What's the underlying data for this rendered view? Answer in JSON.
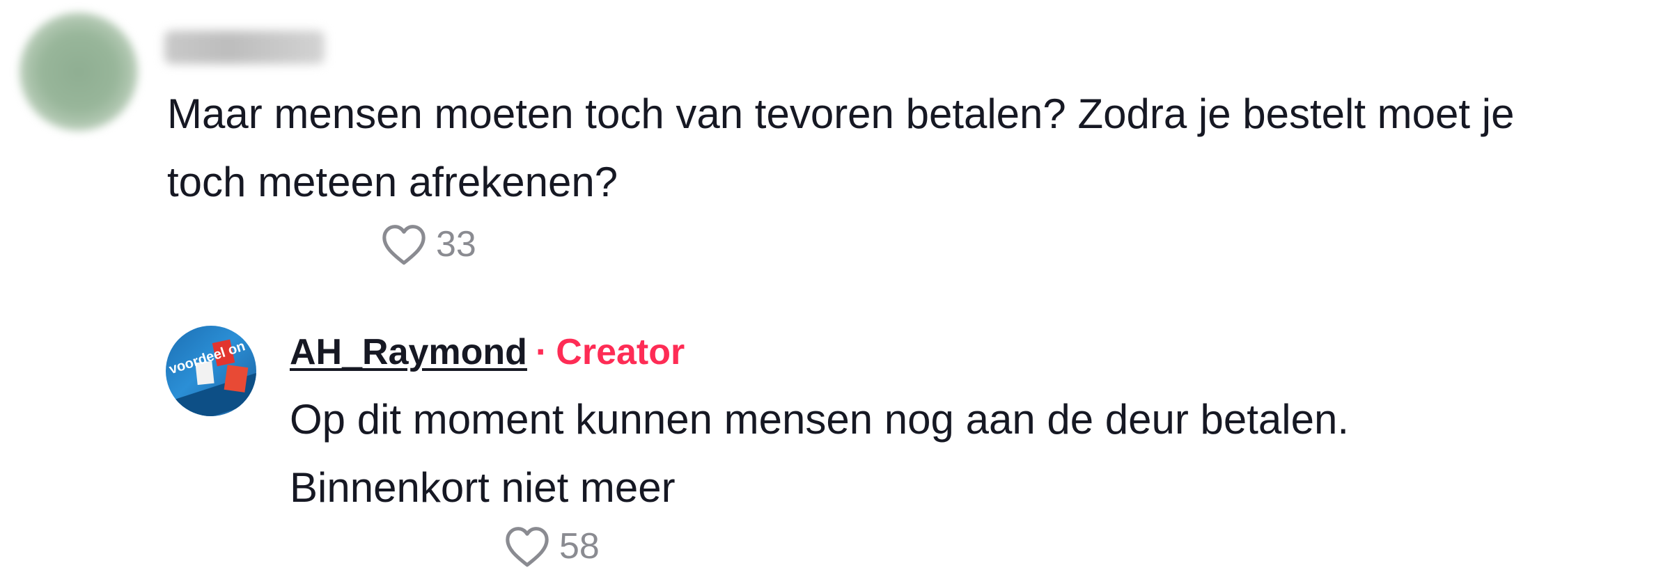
{
  "comments": [
    {
      "username": "",
      "text_lines": [
        "Maar mensen moeten toch van tevoren betalen? Zodra je bestelt moet je",
        "toch meteen afrekenen?"
      ],
      "likes": "33",
      "avatar": "blurred-avatar",
      "like_icon": "heart-outline-icon"
    },
    {
      "username": "AH_Raymond",
      "separator": "·",
      "badge": "Creator",
      "text_lines": [
        "Op dit moment kunnen mensen nog aan de deur betalen.",
        "Binnenkort niet meer"
      ],
      "likes": "58",
      "avatar_text": "voordeel on ag.",
      "like_icon": "heart-outline-icon"
    }
  ],
  "colors": {
    "text": "#161823",
    "muted": "#8a8b91",
    "creator": "#fe2c55",
    "background": "#ffffff"
  }
}
